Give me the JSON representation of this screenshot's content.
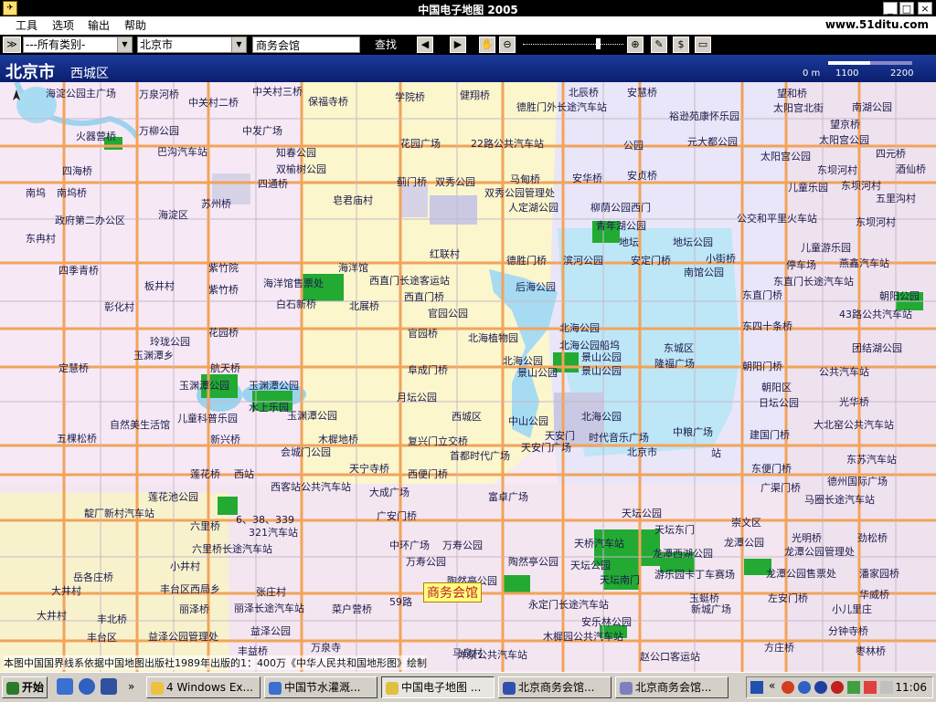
{
  "window": {
    "title": "中国电子地图 2005",
    "site": "www.51ditu.com"
  },
  "menu": [
    "工具",
    "选项",
    "输出",
    "帮助"
  ],
  "toolbar": {
    "category": "---所有类别-",
    "city": "北京市",
    "search_value": "商务会馆",
    "find_label": "查找"
  },
  "header": {
    "city": "北京市",
    "district": "西城区",
    "scale": [
      "0 m",
      "1100",
      "2200"
    ]
  },
  "callout": "商务会馆",
  "copyright": "本图中国国界线系依据中国地图出版社1989年出版的1：400万《中华人民共和国地形图》绘制",
  "labels": [
    [
      "海淀公园主广场",
      50,
      7
    ],
    [
      "万泉河桥",
      152,
      8
    ],
    [
      "中关村二桥",
      206,
      17
    ],
    [
      "中关村三桥",
      276,
      5
    ],
    [
      "保福寺桥",
      337,
      16
    ],
    [
      "学院桥",
      432,
      11
    ],
    [
      "健翔桥",
      503,
      9
    ],
    [
      "德胜门外长途汽车站",
      565,
      22
    ],
    [
      "北辰桥",
      622,
      6
    ],
    [
      "安慧桥",
      686,
      6
    ],
    [
      "望和桥",
      850,
      7
    ],
    [
      "太阳宫北街",
      846,
      23
    ],
    [
      "南湖公园",
      932,
      22
    ],
    [
      "万柳公园",
      152,
      48
    ],
    [
      "中发广场",
      265,
      48
    ],
    [
      "火器营桥",
      83,
      54
    ],
    [
      "知春公园",
      302,
      72
    ],
    [
      "巴沟汽车站",
      172,
      71
    ],
    [
      "双榆树公园",
      302,
      90
    ],
    [
      "花园广场",
      438,
      62
    ],
    [
      "22路公共汽车站",
      515,
      62
    ],
    [
      "公园",
      682,
      64
    ],
    [
      "裕逊苑康怀乐园",
      732,
      32
    ],
    [
      "元大都公园",
      752,
      60
    ],
    [
      "望京桥",
      908,
      41
    ],
    [
      "太阳宫公园",
      896,
      58
    ],
    [
      "太阳宫公园",
      832,
      76
    ],
    [
      "四元桥",
      958,
      73
    ],
    [
      "四海桥",
      68,
      92
    ],
    [
      "四通桥",
      282,
      106
    ],
    [
      "皂君庙村",
      364,
      124
    ],
    [
      "蓟门桥",
      434,
      104
    ],
    [
      "双秀公园",
      476,
      104
    ],
    [
      "马甸桥",
      558,
      101
    ],
    [
      "安华桥",
      626,
      100
    ],
    [
      "安贞桥",
      686,
      97
    ],
    [
      "东坝河村",
      894,
      91
    ],
    [
      "儿童乐园",
      862,
      110
    ],
    [
      "东坝河村",
      920,
      108
    ],
    [
      "酒仙桥",
      980,
      90
    ],
    [
      "南坞",
      28,
      116
    ],
    [
      "南坞桥",
      62,
      116
    ],
    [
      "双秀公园管理处",
      530,
      116
    ],
    [
      "人定湖公园",
      556,
      132
    ],
    [
      "柳荫公园西门",
      646,
      132
    ],
    [
      "苏州桥",
      220,
      128
    ],
    [
      "五里沟村",
      958,
      122
    ],
    [
      "海淀区",
      173,
      140
    ],
    [
      "政府第二办公区",
      60,
      146
    ],
    [
      "东冉村",
      28,
      166
    ],
    [
      "青年湖公园",
      652,
      152
    ],
    [
      "地坛",
      677,
      170
    ],
    [
      "地坛公园",
      736,
      170
    ],
    [
      "公交和平里火车站",
      806,
      144
    ],
    [
      "东坝河村",
      936,
      148
    ],
    [
      "红联村",
      470,
      183
    ],
    [
      "德胜门桥",
      554,
      190
    ],
    [
      "滨河公园",
      616,
      190
    ],
    [
      "安定门桥",
      690,
      190
    ],
    [
      "小街桥",
      772,
      188
    ],
    [
      "南馆公园",
      748,
      203
    ],
    [
      "儿童游乐园",
      876,
      176
    ],
    [
      "停车场",
      860,
      195
    ],
    [
      "燕鑫汽车站",
      918,
      193
    ],
    [
      "四季青桥",
      64,
      201
    ],
    [
      "紫竹院",
      228,
      198
    ],
    [
      "海洋馆",
      370,
      198
    ],
    [
      "海洋馆售票处",
      288,
      215
    ],
    [
      "西直门长途客运站",
      404,
      212
    ],
    [
      "后海公园",
      564,
      219
    ],
    [
      "东直门长途汽车站",
      846,
      213
    ],
    [
      "朝阳公园",
      962,
      229
    ],
    [
      "板井村",
      158,
      218
    ],
    [
      "紫竹桥",
      228,
      222
    ],
    [
      "西直门桥",
      442,
      230
    ],
    [
      "东直门桥",
      812,
      228
    ],
    [
      "彰化村",
      114,
      241
    ],
    [
      "白石新桥",
      302,
      238
    ],
    [
      "北展桥",
      382,
      240
    ],
    [
      "官园公园",
      468,
      248
    ],
    [
      "43路公共汽车站",
      918,
      249
    ],
    [
      "东四十条桥",
      812,
      262
    ],
    [
      "花园桥",
      228,
      269
    ],
    [
      "官园桥",
      446,
      270
    ],
    [
      "北海植物园",
      512,
      275
    ],
    [
      "北海公园",
      612,
      264
    ],
    [
      "北海公园船坞",
      612,
      283
    ],
    [
      "东城区",
      726,
      286
    ],
    [
      "团结湖公园",
      932,
      286
    ],
    [
      "玲珑公园",
      164,
      279
    ],
    [
      "玉渊潭乡",
      146,
      294
    ],
    [
      "北海公园",
      550,
      300
    ],
    [
      "景山公园",
      636,
      296
    ],
    [
      "景山公园",
      566,
      313
    ],
    [
      "景山公园",
      636,
      311
    ],
    [
      "隆福广场",
      716,
      303
    ],
    [
      "朝阳门桥",
      812,
      306
    ],
    [
      "公共汽车站",
      896,
      312
    ],
    [
      "定慧桥",
      64,
      308
    ],
    [
      "航天桥",
      230,
      308
    ],
    [
      "阜成门桥",
      446,
      310
    ],
    [
      "朝阳区",
      833,
      329
    ],
    [
      "日坛公园",
      830,
      346
    ],
    [
      "光华桥",
      918,
      345
    ],
    [
      "玉渊潭公园",
      196,
      327
    ],
    [
      "玉渊潭公园",
      272,
      327
    ],
    [
      "月坛公园",
      434,
      340
    ],
    [
      "水上乐园",
      272,
      351
    ],
    [
      "儿童科普乐园",
      194,
      363
    ],
    [
      "玉渊潭公园",
      314,
      360
    ],
    [
      "西城区",
      494,
      361
    ],
    [
      "中山公园",
      556,
      366
    ],
    [
      "北海公园",
      636,
      361
    ],
    [
      "大北窑公共汽车站",
      890,
      370
    ],
    [
      "自然美生活馆",
      120,
      370
    ],
    [
      "天安门",
      596,
      382
    ],
    [
      "时代音乐广场",
      644,
      384
    ],
    [
      "中粮广场",
      736,
      378
    ],
    [
      "建国门桥",
      820,
      381
    ],
    [
      "五棵松桥",
      62,
      385
    ],
    [
      "新兴桥",
      230,
      386
    ],
    [
      "木樨地桥",
      348,
      386
    ],
    [
      "复兴门立交桥",
      446,
      388
    ],
    [
      "首都时代广场",
      492,
      404
    ],
    [
      "天安门广场",
      570,
      395
    ],
    [
      "北京市",
      686,
      400
    ],
    [
      "站",
      778,
      401
    ],
    [
      "会城门公园",
      307,
      400
    ],
    [
      "天宁寺桥",
      382,
      418
    ],
    [
      "西便门桥",
      446,
      424
    ],
    [
      "东便门桥",
      822,
      418
    ],
    [
      "东苏汽车站",
      926,
      408
    ],
    [
      "德州国际广场",
      905,
      432
    ],
    [
      "莲花桥",
      208,
      424
    ],
    [
      "西站",
      256,
      424
    ],
    [
      "西客站公共汽车站",
      296,
      438
    ],
    [
      "广渠门桥",
      832,
      439
    ],
    [
      "马圈长途汽车站",
      880,
      452
    ],
    [
      "莲花池公园",
      162,
      449
    ],
    [
      "大成广场",
      404,
      444
    ],
    [
      "富卓广场",
      534,
      449
    ],
    [
      "天坛公园",
      680,
      467
    ],
    [
      "崇文区",
      800,
      477
    ],
    [
      "靛厂新村汽车站",
      92,
      467
    ],
    [
      "六里桥",
      208,
      481
    ],
    [
      "广安门桥",
      412,
      470
    ],
    [
      "6、38、339",
      258,
      474
    ],
    [
      "321汽车站",
      272,
      488
    ],
    [
      "天坛东门",
      716,
      485
    ],
    [
      "光明桥",
      866,
      494
    ],
    [
      "劲松桥",
      938,
      494
    ],
    [
      "六里桥长途汽车站",
      210,
      506
    ],
    [
      "中环广场",
      426,
      502
    ],
    [
      "万寿公园",
      484,
      502
    ],
    [
      "天桥汽车站",
      628,
      500
    ],
    [
      "龙潭西湖公园",
      714,
      511
    ],
    [
      "龙潭公园",
      792,
      499
    ],
    [
      "龙潭公园管理处",
      858,
      509
    ],
    [
      "小井村",
      186,
      525
    ],
    [
      "万寿公园",
      444,
      520
    ],
    [
      "陶然亭公园",
      556,
      520
    ],
    [
      "天坛公园",
      624,
      524
    ],
    [
      "岳各庄桥",
      80,
      537
    ],
    [
      "陶然亭公园",
      489,
      541
    ],
    [
      "天坛南门",
      656,
      540
    ],
    [
      "游乐园卡丁车赛场",
      716,
      534
    ],
    [
      "龙潭公园售票处",
      838,
      533
    ],
    [
      "潘家园桥",
      940,
      533
    ],
    [
      "大井村",
      56,
      552
    ],
    [
      "丰台区西局乡",
      175,
      550
    ],
    [
      "张庄村",
      280,
      553
    ],
    [
      "59路",
      426,
      564
    ],
    [
      "永定门长途汽车站",
      578,
      567
    ],
    [
      "左安门桥",
      840,
      560
    ],
    [
      "华威桥",
      940,
      556
    ],
    [
      "玉蜓桥",
      754,
      560
    ],
    [
      "新城广场",
      756,
      572
    ],
    [
      "丰北桥",
      106,
      583
    ],
    [
      "丽泽桥",
      196,
      572
    ],
    [
      "丽泽长途汽车站",
      256,
      571
    ],
    [
      "菜户营桥",
      363,
      572
    ],
    [
      "安乐林公园",
      636,
      586
    ],
    [
      "大井村",
      40,
      579
    ],
    [
      "小儿里庄",
      910,
      572
    ],
    [
      "方庄桥",
      836,
      614
    ],
    [
      "分钟寺桥",
      906,
      596
    ],
    [
      "丰台区",
      95,
      603
    ],
    [
      "益泽公园管理处",
      162,
      602
    ],
    [
      "益泽公园",
      274,
      596
    ],
    [
      "木樨园公共汽车站",
      594,
      602
    ],
    [
      "赵公口客运站",
      700,
      624
    ],
    [
      "枣林桥",
      936,
      618
    ],
    [
      "丰益桥",
      260,
      618
    ],
    [
      "万泉寺",
      340,
      614
    ],
    [
      "马泉村",
      495,
      620
    ],
    [
      "洋泉公共汽车站",
      500,
      622
    ]
  ],
  "taskbar": {
    "start": "开始",
    "tasks": [
      "4 Windows Ex...",
      "中国节水灌溉...",
      "中国电子地图 ...",
      "北京商务会馆...",
      "北京商务会馆..."
    ],
    "clock": "11:06"
  }
}
